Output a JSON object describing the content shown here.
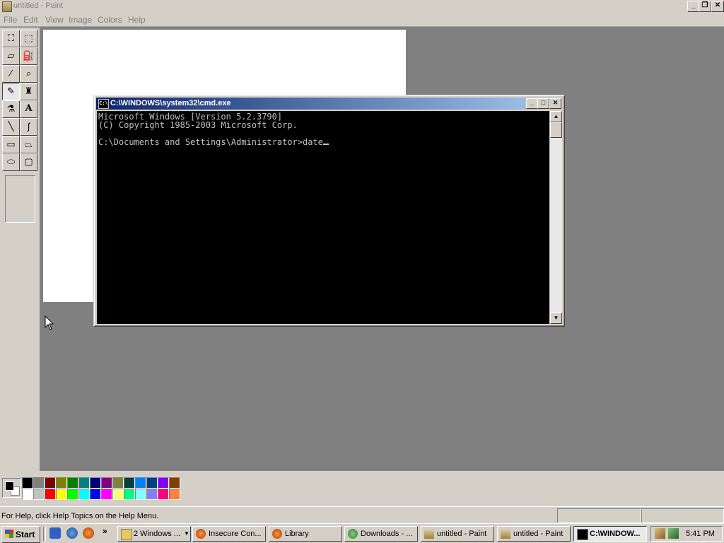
{
  "app": {
    "title": "untitled - Paint",
    "caption_buttons": [
      "_",
      "❐",
      "✕"
    ]
  },
  "menu": [
    "File",
    "Edit",
    "View",
    "Image",
    "Colors",
    "Help"
  ],
  "toolbox": {
    "tools": [
      {
        "name": "free-form-select",
        "glyph": "⛶"
      },
      {
        "name": "select",
        "glyph": "⬚"
      },
      {
        "name": "eraser",
        "glyph": "▱"
      },
      {
        "name": "fill-with-color",
        "glyph": "⛽"
      },
      {
        "name": "pick-color",
        "glyph": "⁄"
      },
      {
        "name": "magnifier",
        "glyph": "⌕"
      },
      {
        "name": "pencil",
        "glyph": "✎"
      },
      {
        "name": "brush",
        "glyph": "♜"
      },
      {
        "name": "airbrush",
        "glyph": "⚗"
      },
      {
        "name": "text",
        "glyph": "A"
      },
      {
        "name": "line",
        "glyph": "╲"
      },
      {
        "name": "curve",
        "glyph": "∫"
      },
      {
        "name": "rectangle",
        "glyph": "▭"
      },
      {
        "name": "polygon",
        "glyph": "⏢"
      },
      {
        "name": "ellipse",
        "glyph": "⬭"
      },
      {
        "name": "rounded-rectangle",
        "glyph": "▢"
      }
    ],
    "selected": "pencil"
  },
  "palette": {
    "foreground": "#000000",
    "background": "#ffffff",
    "top_row": [
      "#000000",
      "#808080",
      "#800000",
      "#808000",
      "#008000",
      "#008080",
      "#000080",
      "#800080",
      "#808040",
      "#004040",
      "#0080ff",
      "#004080",
      "#8000ff",
      "#804000"
    ],
    "bottom_row": [
      "#ffffff",
      "#c0c0c0",
      "#ff0000",
      "#ffff00",
      "#00ff00",
      "#00ffff",
      "#0000ff",
      "#ff00ff",
      "#ffff80",
      "#00ff80",
      "#80ffff",
      "#8080ff",
      "#ff0080",
      "#ff8040"
    ]
  },
  "status": {
    "message": "For Help, click Help Topics on the Help Menu."
  },
  "cmd": {
    "title": "C:\\WINDOWS\\system32\\cmd.exe",
    "icon_text": "C:\\",
    "lines": [
      "Microsoft Windows [Version 5.2.3790]",
      "(C) Copyright 1985-2003 Microsoft Corp.",
      "",
      "C:\\Documents and Settings\\Administrator>date"
    ]
  },
  "taskbar": {
    "start_label": "Start",
    "quick_launch_more": "»",
    "tasks": [
      {
        "label": "2 Windows ...",
        "icon": "folder-icon",
        "color": "#e8c860",
        "active": false
      },
      {
        "label": "Insecure Con...",
        "icon": "firefox-icon",
        "color": "#e06020",
        "active": false
      },
      {
        "label": "Library",
        "icon": "firefox-icon",
        "color": "#e06020",
        "active": false
      },
      {
        "label": "Downloads - ...",
        "icon": "downloads-icon",
        "color": "#40a040",
        "active": false
      },
      {
        "label": "untitled - Paint",
        "icon": "paint-icon",
        "color": "#c0a060",
        "active": false
      },
      {
        "label": "untitled - Paint",
        "icon": "paint-icon",
        "color": "#c0a060",
        "active": false
      },
      {
        "label": "C:\\WINDOW...",
        "icon": "cmd-icon",
        "color": "#000000",
        "active": true
      }
    ],
    "clock": "5:41 PM"
  }
}
